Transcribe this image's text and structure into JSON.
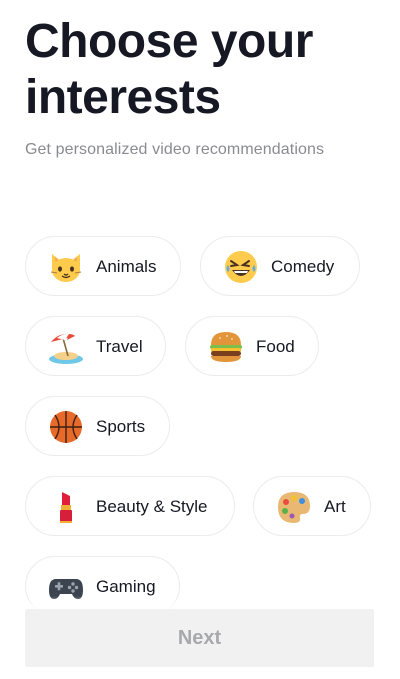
{
  "header": {
    "title_line1": "Choose your",
    "title_line2": "interests",
    "subtitle": "Get personalized video recommendations"
  },
  "interests": [
    {
      "label": "Animals",
      "icon": "cat-face-icon"
    },
    {
      "label": "Comedy",
      "icon": "laughing-face-icon"
    },
    {
      "label": "Travel",
      "icon": "beach-umbrella-icon"
    },
    {
      "label": "Food",
      "icon": "hamburger-icon"
    },
    {
      "label": "Sports",
      "icon": "basketball-icon"
    },
    {
      "label": "Beauty & Style",
      "icon": "lipstick-icon"
    },
    {
      "label": "Art",
      "icon": "palette-icon"
    },
    {
      "label": "Gaming",
      "icon": "game-controller-icon"
    }
  ],
  "footer": {
    "next_label": "Next"
  },
  "colors": {
    "title": "#161823",
    "subtitle": "#8a8b91",
    "chip_border": "#ececec",
    "button_bg": "#f1f1f2",
    "button_text": "#a8a9ad"
  }
}
